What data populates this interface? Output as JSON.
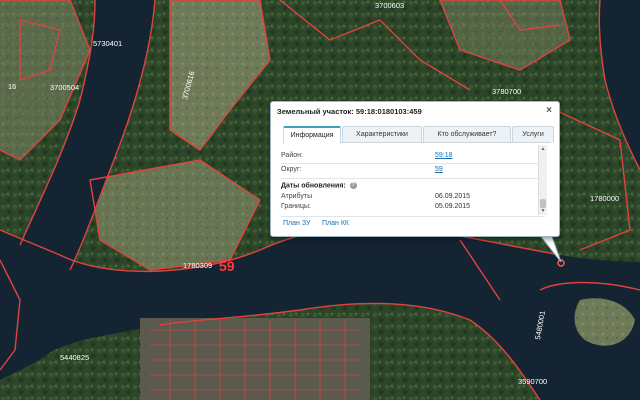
{
  "map": {
    "labels": [
      {
        "text": "5730401"
      },
      {
        "text": "3700603"
      },
      {
        "text": "3700504"
      },
      {
        "text": "3700616"
      },
      {
        "text": "3780700"
      },
      {
        "text": "1780000"
      },
      {
        "text": "1780309"
      },
      {
        "text": "59"
      },
      {
        "text": "5440825"
      },
      {
        "text": "5480001"
      },
      {
        "text": "3590700"
      },
      {
        "text": "16"
      }
    ],
    "colors": {
      "water": "#142433",
      "forest": "#2f4a2b",
      "field": "#6f7a59",
      "boundary": "#e0433e"
    }
  },
  "popup": {
    "title": "Земельный участок: 59:18:0180103:459",
    "close_label": "×",
    "tabs": [
      "Информация",
      "Характеристики",
      "Кто обслуживает?",
      "Услуги"
    ],
    "rows": [
      {
        "label": "Район:",
        "value": "59:18"
      },
      {
        "label": "Округ:",
        "value": "59"
      }
    ],
    "updates_title": "Даты обновления:",
    "updates": [
      {
        "label": "Атрибуты",
        "value": "06.09.2015"
      },
      {
        "label": "Границы:",
        "value": "05.09.2015"
      }
    ],
    "links": [
      "План ЗУ",
      "План КК"
    ]
  }
}
